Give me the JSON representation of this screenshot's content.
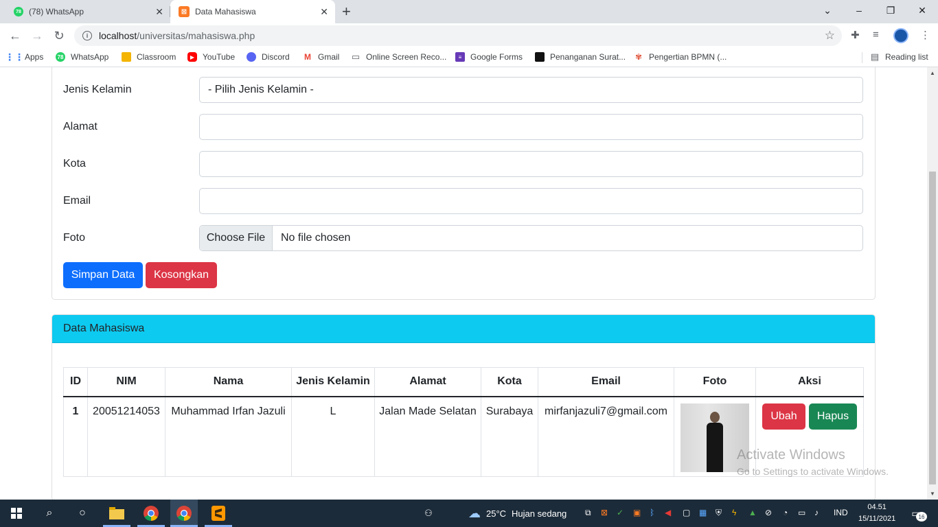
{
  "browser": {
    "tabs": [
      {
        "title": "(78) WhatsApp",
        "favicon": "whatsapp-icon",
        "badge": "78"
      },
      {
        "title": "Data Mahasiswa",
        "favicon": "xampp-icon",
        "active": true
      }
    ],
    "url_host": "localhost",
    "url_path": "/universitas/mahasiswa.php",
    "bookmarks": [
      {
        "label": "Apps",
        "icon": "apps-grid-icon"
      },
      {
        "label": "WhatsApp",
        "icon": "whatsapp-icon"
      },
      {
        "label": "Classroom",
        "icon": "classroom-icon"
      },
      {
        "label": "YouTube",
        "icon": "youtube-icon"
      },
      {
        "label": "Discord",
        "icon": "discord-icon"
      },
      {
        "label": "Gmail",
        "icon": "gmail-icon"
      },
      {
        "label": "Online Screen Reco...",
        "icon": "monitor-icon"
      },
      {
        "label": "Google Forms",
        "icon": "google-forms-icon"
      },
      {
        "label": "Penanganan Surat...",
        "icon": "document-icon"
      },
      {
        "label": "Pengertian BPMN (...",
        "icon": "bpmn-icon"
      }
    ],
    "reading_list": "Reading list"
  },
  "form": {
    "gender_label": "Jenis Kelamin",
    "gender_value": "- Pilih Jenis Kelamin -",
    "address_label": "Alamat",
    "city_label": "Kota",
    "email_label": "Email",
    "photo_label": "Foto",
    "file_button": "Choose File",
    "file_status": "No file chosen",
    "save_button": "Simpan Data",
    "clear_button": "Kosongkan"
  },
  "table_card": {
    "title": "Data Mahasiswa",
    "columns": [
      "ID",
      "NIM",
      "Nama",
      "Jenis Kelamin",
      "Alamat",
      "Kota",
      "Email",
      "Foto",
      "Aksi"
    ],
    "rows": [
      {
        "id": "1",
        "nim": "20051214053",
        "nama": "Muhammad Irfan Jazuli",
        "jenis_kelamin": "L",
        "alamat": "Jalan Made Selatan",
        "kota": "Surabaya",
        "email": "mirfanjazuli7@gmail.com",
        "edit_button": "Ubah",
        "delete_button": "Hapus"
      }
    ]
  },
  "watermark": {
    "line1": "Activate Windows",
    "line2": "Go to Settings to activate Windows."
  },
  "taskbar": {
    "weather_temp": "25°C",
    "weather_text": "Hujan sedang",
    "language": "IND",
    "time": "04.51",
    "date": "15/11/2021",
    "notification_count": "16"
  },
  "colors": {
    "primary": "#0d6efd",
    "danger": "#dc3545",
    "success": "#198754",
    "info": "#0dcaf0"
  }
}
